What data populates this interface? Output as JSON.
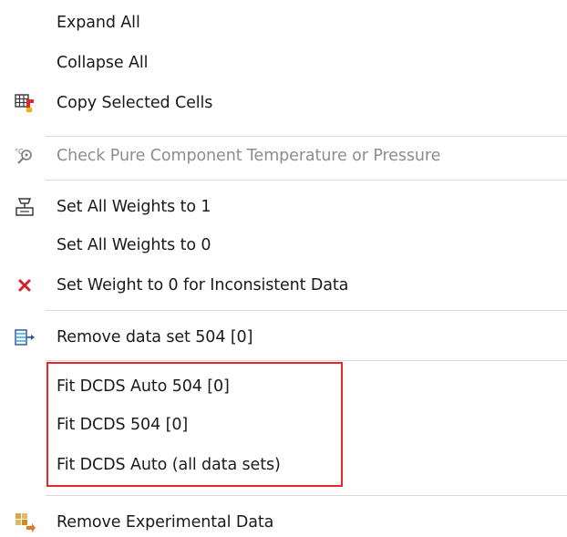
{
  "menu": {
    "items": [
      {
        "label": "Expand All",
        "icon": "",
        "enabled": true
      },
      {
        "label": "Collapse All",
        "icon": "",
        "enabled": true
      },
      {
        "label": "Copy Selected Cells",
        "icon": "copy-cells-icon",
        "enabled": true
      },
      {
        "label": "Check Pure Component Temperature or Pressure",
        "icon": "check-pure-component-icon",
        "enabled": false
      },
      {
        "label": "Set All Weights to 1",
        "icon": "weight-scale-icon",
        "enabled": true
      },
      {
        "label": "Set All Weights to 0",
        "icon": "",
        "enabled": true
      },
      {
        "label": "Set Weight to 0 for Inconsistent Data",
        "icon": "red-x-icon",
        "enabled": true
      },
      {
        "label": "Remove data set 504 [0]",
        "icon": "remove-dataset-icon",
        "enabled": true
      },
      {
        "label": "Fit DCDS Auto 504 [0]",
        "icon": "",
        "enabled": true
      },
      {
        "label": "Fit DCDS 504 [0]",
        "icon": "",
        "enabled": true
      },
      {
        "label": "Fit DCDS Auto (all data sets)",
        "icon": "",
        "enabled": true
      },
      {
        "label": "Remove Experimental Data",
        "icon": "remove-experimental-data-icon",
        "enabled": true
      }
    ]
  },
  "colors": {
    "highlight_border": "#e8252a",
    "text": "#1a1a1a",
    "disabled_text": "#8d8d8d",
    "separator": "#d9d9d9"
  }
}
